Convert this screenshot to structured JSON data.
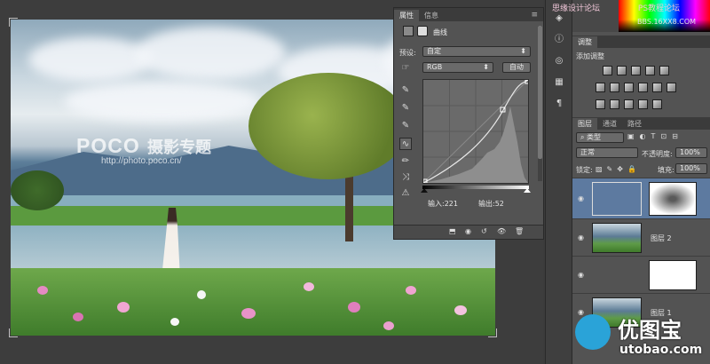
{
  "watermark": {
    "logo": "POCO",
    "title_cn": "摄影专题",
    "url": "http://photo.poco.cn/"
  },
  "properties": {
    "tab_properties": "属性",
    "tab_info": "信息",
    "panel_title": "曲线",
    "preset_label": "预设:",
    "preset_value": "自定",
    "channel_value": "RGB",
    "auto_label": "自动",
    "input_label": "输入:",
    "input_value": "221",
    "output_label": "输出:",
    "output_value": "52"
  },
  "adjustments": {
    "tab": "调整",
    "add_label": "添加调整"
  },
  "layers": {
    "tab_layers": "图层",
    "tab_channels": "通道",
    "tab_paths": "路径",
    "filter_kind": "类型",
    "blend_mode": "正常",
    "opacity_label": "不透明度:",
    "opacity_value": "100%",
    "lock_label": "锁定:",
    "fill_label": "填充:",
    "fill_value": "100%",
    "items": [
      {
        "name": ""
      },
      {
        "name": "图层 2"
      },
      {
        "name": ""
      },
      {
        "name": "图层 1"
      }
    ]
  },
  "site_watermarks": {
    "top_cn": "思缘设计论坛",
    "top_ps": "PS教程论坛",
    "top_url": "BBS.16XX8.COM",
    "bottom_cn": "优图宝",
    "bottom_url": "utobao.com"
  },
  "colors": {
    "panel_bg": "#535353",
    "tab_bar": "#3b3b3b",
    "utobao_blue": "#2aa3d8"
  }
}
